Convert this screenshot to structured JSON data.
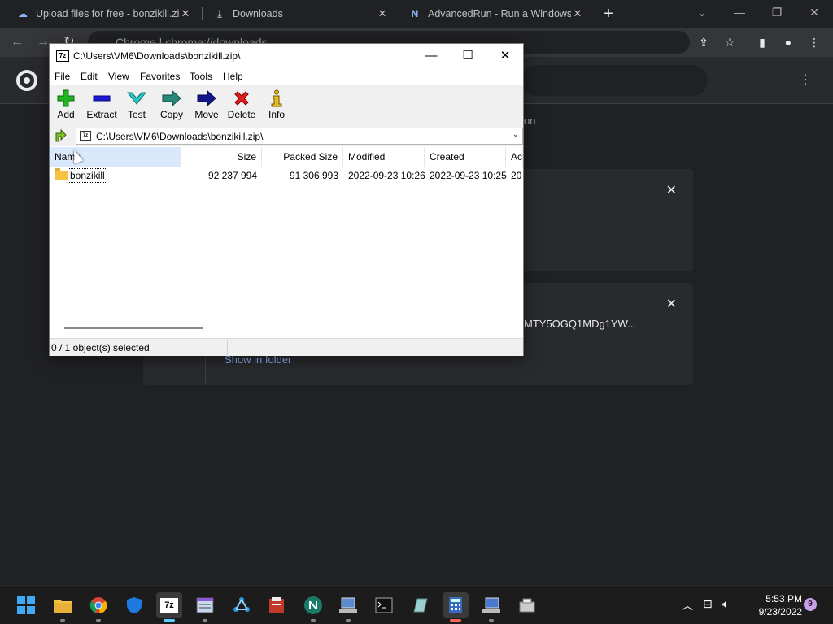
{
  "browser": {
    "tabs": [
      {
        "icon": "cloud-upload-icon",
        "label": "Upload files for free - bonzikill.zi",
        "close": "✕"
      },
      {
        "icon": "download-icon",
        "label": "Downloads",
        "close": "✕"
      },
      {
        "icon": "n-logo-icon",
        "label": "AdvancedRun - Run a Windows p",
        "close": "✕"
      }
    ],
    "new_tab": "+",
    "omnibox_text": "Chrome | chrome://downloads"
  },
  "downloads_page": {
    "bg_text_fragment": "on",
    "card2_filename_fragment": "MTY5OGQ1MDg1YW...",
    "card2_link": "Show in folder"
  },
  "zip_window": {
    "title": "C:\\Users\\VM6\\Downloads\\bonzikill.zip\\",
    "title_icon": "7z",
    "menu": [
      "File",
      "Edit",
      "View",
      "Favorites",
      "Tools",
      "Help"
    ],
    "toolbar": [
      {
        "label": "Add",
        "icon": "add-icon"
      },
      {
        "label": "Extract",
        "icon": "extract-icon"
      },
      {
        "label": "Test",
        "icon": "test-icon"
      },
      {
        "label": "Copy",
        "icon": "copy-icon"
      },
      {
        "label": "Move",
        "icon": "move-icon"
      },
      {
        "label": "Delete",
        "icon": "delete-icon"
      },
      {
        "label": "Info",
        "icon": "info-icon"
      }
    ],
    "address": "C:\\Users\\VM6\\Downloads\\bonzikill.zip\\",
    "columns": [
      "Name",
      "Size",
      "Packed Size",
      "Modified",
      "Created",
      "Ac"
    ],
    "rows": [
      {
        "name": "bonzikill",
        "size": "92 237 994",
        "packed_size": "91 306 993",
        "modified": "2022-09-23 10:26",
        "created": "2022-09-23 10:25",
        "accessed": "20"
      }
    ],
    "status": "0 / 1 object(s) selected"
  },
  "taskbar": {
    "apps": [
      "start",
      "file-explorer",
      "chrome",
      "defender",
      "7zip",
      "notepad",
      "network-app",
      "archive-app",
      "nirsoft-app",
      "computer-app",
      "terminal",
      "notepad-app",
      "calculator",
      "remote-app",
      "package-app"
    ],
    "time": "5:53 PM",
    "date": "9/23/2022",
    "notifications": "9"
  }
}
